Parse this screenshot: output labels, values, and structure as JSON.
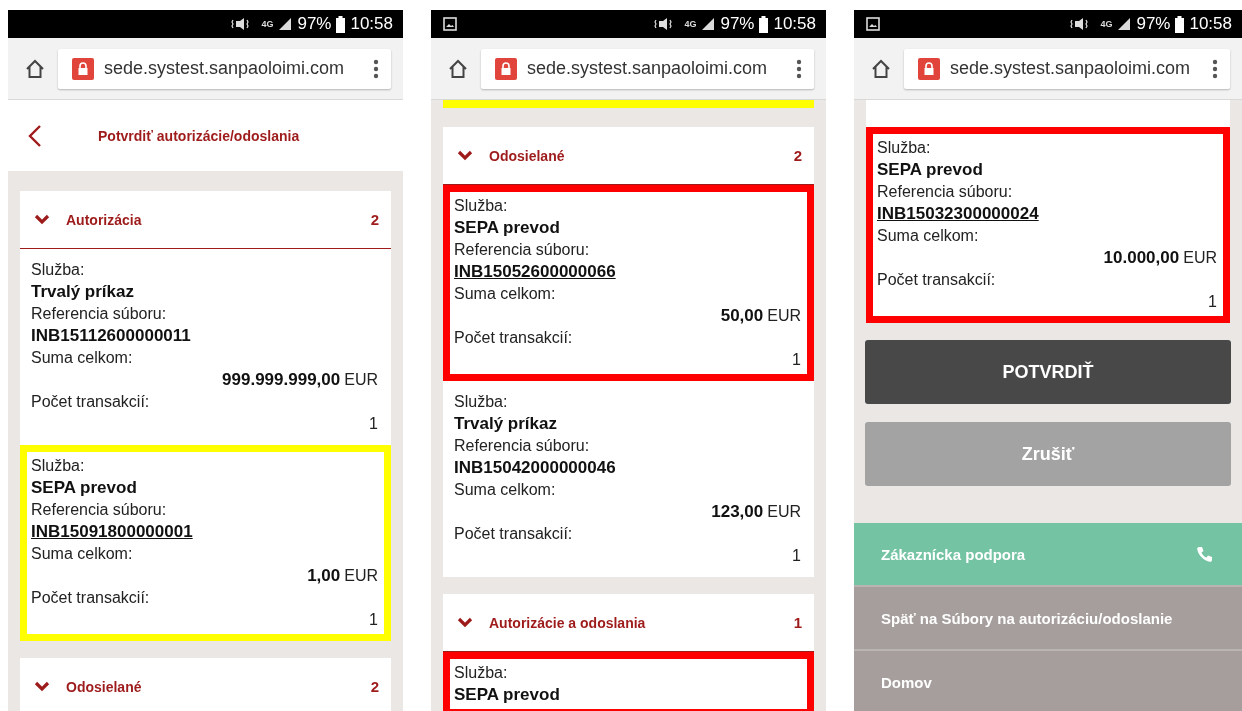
{
  "screens": [
    {
      "status_bar": {
        "notification_icon": false,
        "network": "4G",
        "battery": "97%",
        "time": "10:58"
      },
      "address_bar": {
        "url": "sede.systest.sanpaoloimi.com"
      },
      "header": {
        "title": "Potvrdiť autorizácie/odoslania"
      },
      "content": [
        {
          "kind": "section",
          "title": "Autorizácia",
          "count": "2",
          "expanded": true,
          "records": [
            {
              "service_label": "Služba:",
              "service": "Trvalý príkaz",
              "reference_label": "Referencia súboru:",
              "reference": "INB15112600000011",
              "reference_is_link": false,
              "total_label": "Suma celkom:",
              "amount": "999.999.999,00",
              "currency": "EUR",
              "count_label": "Počet transakcií:",
              "count": "1"
            },
            {
              "color": "#ffff00",
              "service_label": "Služba:",
              "service": "SEPA prevod",
              "reference_label": "Referencia súboru:",
              "reference": "INB15091800000001",
              "reference_is_link": true,
              "total_label": "Suma celkom:",
              "amount": "1,00",
              "currency": "EUR",
              "count_label": "Počet transakcií:",
              "count": "1"
            }
          ]
        },
        {
          "kind": "section",
          "title": "Odosielané",
          "count": "2",
          "expanded": true
        }
      ]
    },
    {
      "status_bar": {
        "notification_icon": true,
        "network": "4G",
        "battery": "97%",
        "time": "10:58"
      },
      "address_bar": {
        "url": "sede.systest.sanpaoloimi.com"
      },
      "content": [
        {
          "kind": "fragment",
          "color": "#ffff00"
        },
        {
          "kind": "section",
          "title": "Odosielané",
          "count": "2",
          "expanded": true,
          "records": [
            {
              "color": "#ff0000",
              "service_label": "Služba:",
              "service": "SEPA prevod",
              "reference_label": "Referencia súboru:",
              "reference": "INB15052600000066",
              "reference_is_link": true,
              "total_label": "Suma celkom:",
              "amount": "50,00",
              "currency": "EUR",
              "count_label": "Počet transakcií:",
              "count": "1"
            },
            {
              "service_label": "Služba:",
              "service": "Trvalý príkaz",
              "reference_label": "Referencia súboru:",
              "reference": "INB15042000000046",
              "reference_is_link": false,
              "total_label": "Suma celkom:",
              "amount": "123,00",
              "currency": "EUR",
              "count_label": "Počet transakcií:",
              "count": "1"
            }
          ]
        },
        {
          "kind": "section",
          "title": "Autorizácie a odoslania",
          "count": "1",
          "expanded": true,
          "records": [
            {
              "color": "#ff0000",
              "service_label": "Služba:",
              "service": "SEPA prevod"
            }
          ]
        }
      ]
    },
    {
      "status_bar": {
        "notification_icon": true,
        "network": "4G",
        "battery": "97%",
        "time": "10:58"
      },
      "address_bar": {
        "url": "sede.systest.sanpaoloimi.com"
      },
      "content": [
        {
          "kind": "continued",
          "records": [
            {
              "color": "#ff0000",
              "service_label": "Služba:",
              "service": "SEPA prevod",
              "reference_label": "Referencia súboru:",
              "reference": "INB15032300000024",
              "reference_is_link": true,
              "total_label": "Suma celkom:",
              "amount": "10.000,00",
              "currency": "EUR",
              "count_label": "Počet transakcií:",
              "count": "1"
            }
          ]
        },
        {
          "kind": "actions",
          "buttons": [
            {
              "label": "POTVRDIŤ",
              "kind": "primary"
            },
            {
              "label": "Zrušiť",
              "kind": "secondary"
            }
          ]
        },
        {
          "kind": "footer",
          "links": [
            {
              "label": "Zákaznícka podpora",
              "kind": "support"
            },
            {
              "label": "Späť na Súbory na autorizáciu/odoslanie",
              "kind": "link"
            },
            {
              "label": "Domov",
              "kind": "link"
            }
          ]
        }
      ]
    }
  ]
}
